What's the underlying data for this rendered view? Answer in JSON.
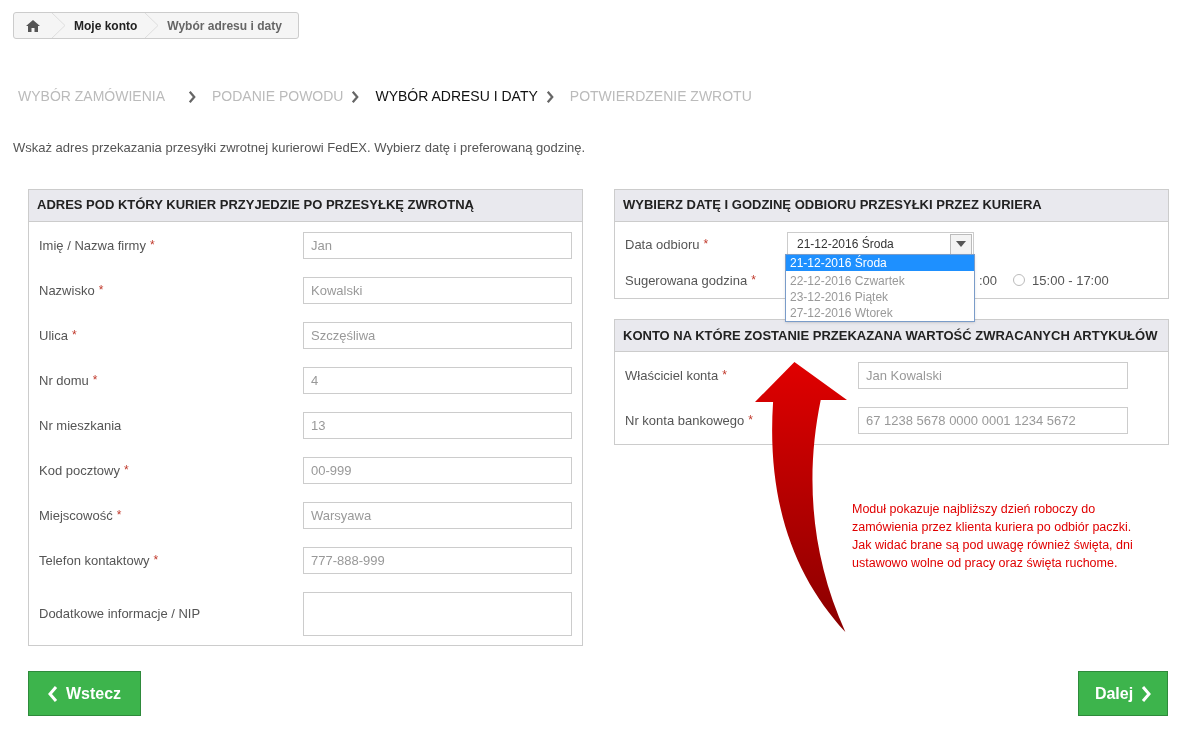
{
  "breadcrumb": [
    {
      "label": "Moje konto",
      "selected": false
    },
    {
      "label": "Wybór adresu i daty",
      "selected": true
    }
  ],
  "steps": [
    {
      "label": "WYBÓR ZAMÓWIENIA",
      "selected": false
    },
    {
      "label": "PODANIE POWODU",
      "selected": false
    },
    {
      "label": "WYBÓR ADRESU I DATY",
      "selected": true
    },
    {
      "label": "POTWIERDZENIE ZWROTU",
      "selected": false
    }
  ],
  "required_mark": "*",
  "intro": "Wskaż adres przekazania przesyłki zwrotnej kurierowi FedEX. Wybierz datę i preferowaną godzinę.",
  "address_panel": {
    "title": "ADRES POD KTÓRY KURIER PRZYJEDZIE PO PRZESYŁKĘ ZWROTNĄ",
    "fields": [
      {
        "label": "Imię / Nazwa firmy",
        "required": true,
        "value": "Jan",
        "kind": "input"
      },
      {
        "label": "Nazwisko",
        "required": true,
        "value": "Kowalski",
        "kind": "input"
      },
      {
        "label": "Ulica",
        "required": true,
        "value": "Szczęśliwa",
        "kind": "input"
      },
      {
        "label": "Nr domu",
        "required": true,
        "value": "4",
        "kind": "input"
      },
      {
        "label": "Nr mieszkania",
        "required": false,
        "value": "13",
        "kind": "input"
      },
      {
        "label": "Kod pocztowy",
        "required": true,
        "value": "00-999",
        "kind": "input"
      },
      {
        "label": "Miejscowość",
        "required": true,
        "value": "Warsyawa",
        "kind": "input"
      },
      {
        "label": "Telefon kontaktowy",
        "required": true,
        "value": "777-888-999",
        "kind": "input"
      },
      {
        "label": "Dodatkowe informacje / NIP",
        "required": false,
        "kind": "textarea"
      }
    ]
  },
  "date_panel": {
    "title": "WYBIERZ DATĘ I GODZINĘ ODBIORU PRZESYŁKI PRZEZ KURIERA",
    "date_label": "Data odbioru",
    "date_required": true,
    "date_value": "21-12-2016 Środa",
    "dropdown": [
      {
        "label": "21-12-2016 Środa",
        "selected": true
      },
      {
        "label": "22-12-2016 Czwartek",
        "selected": false
      },
      {
        "label": "23-12-2016 Piątek",
        "selected": false
      },
      {
        "label": "27-12-2016 Wtorek",
        "selected": false
      }
    ],
    "time_label": "Sugerowana godzina",
    "time_required": true,
    "time_options": [
      {
        "label": ":00",
        "kind": "partial"
      },
      {
        "label": "15:00 - 17:00",
        "kind": "radio",
        "selected": false
      }
    ]
  },
  "account_panel": {
    "title": "KONTO NA KTÓRE ZOSTANIE PRZEKAZANA WARTOŚĆ ZWRACANYCH ARTYKUŁÓW",
    "fields": [
      {
        "label": "Właściciel konta",
        "required": true,
        "value": "Jan Kowalski",
        "kind": "input"
      },
      {
        "label": "Nr konta bankowego",
        "required": true,
        "value": "67 1238 5678 0000 0001 1234 5672",
        "kind": "input"
      }
    ]
  },
  "note": "Moduł pokazuje najbliższy dzień roboczy do zamówienia przez klienta kuriera po odbiór paczki. Jak widać brane są pod uwagę również święta, dni ustawowo wolne od pracy oraz święta ruchome.",
  "back_button": "Wstecz",
  "next_button": "Dalej"
}
